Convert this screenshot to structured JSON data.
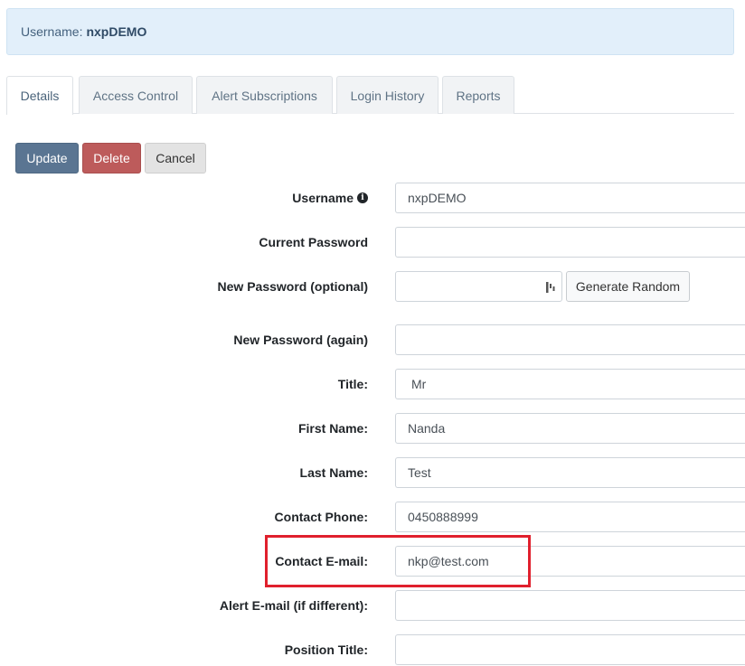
{
  "banner": {
    "label": "Username:",
    "username": "nxpDEMO"
  },
  "tabs": [
    {
      "label": "Details"
    },
    {
      "label": "Access Control"
    },
    {
      "label": "Alert Subscriptions"
    },
    {
      "label": "Login History"
    },
    {
      "label": "Reports"
    }
  ],
  "actions": {
    "update": "Update",
    "delete": "Delete",
    "cancel": "Cancel"
  },
  "form": {
    "username": {
      "label": "Username",
      "value": "nxpDEMO"
    },
    "current_password": {
      "label": "Current Password",
      "value": ""
    },
    "new_password": {
      "label": "New Password (optional)",
      "value": "",
      "generate_label": "Generate Random"
    },
    "new_password_again": {
      "label": "New Password (again)",
      "value": ""
    },
    "title": {
      "label": "Title:",
      "value": "Mr"
    },
    "first_name": {
      "label": "First Name:",
      "value": "Nanda"
    },
    "last_name": {
      "label": "Last Name:",
      "value": "Test"
    },
    "contact_phone": {
      "label": "Contact Phone:",
      "value": "0450888999"
    },
    "contact_email": {
      "label": "Contact E-mail:",
      "value": "nkp@test.com"
    },
    "alert_email": {
      "label": "Alert E-mail (if different):",
      "value": ""
    },
    "position_title": {
      "label": "Position Title:",
      "value": ""
    }
  },
  "colors": {
    "highlight": "#e0202d",
    "update": "#5a7592",
    "delete": "#bd5b5b"
  }
}
